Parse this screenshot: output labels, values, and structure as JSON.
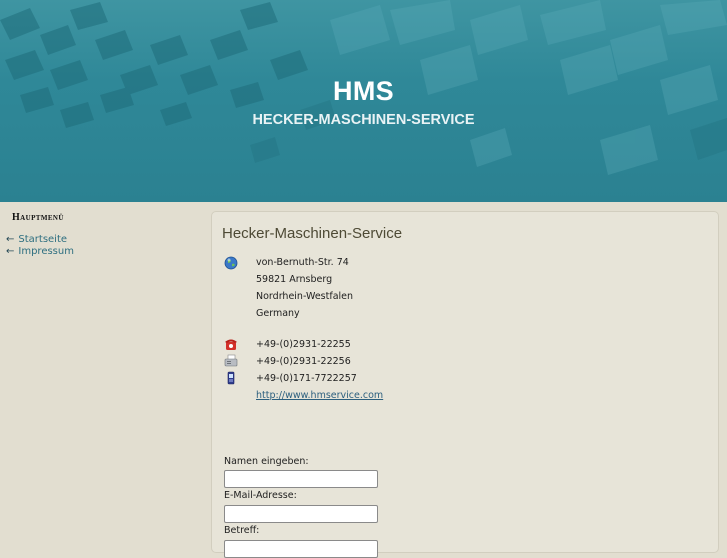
{
  "header": {
    "title": "HMS",
    "subtitle": "HECKER-MASCHINEN-SERVICE"
  },
  "sidebar": {
    "heading": "Hauptmenü",
    "items": [
      {
        "label": "Startseite",
        "icon": "arrow-left-icon"
      },
      {
        "label": "Impressum",
        "icon": "arrow-left-icon"
      }
    ]
  },
  "contact": {
    "title": "Hecker-Maschinen-Service",
    "address_icon": "globe-icon",
    "street": "von-Bernuth-Str. 74",
    "city": "59821 Arnsberg",
    "region": "Nordrhein-Westfalen",
    "country": "Germany",
    "phone_icon": "telephone-icon",
    "phone": "+49-(0)2931-22255",
    "fax_icon": "fax-icon",
    "fax": "+49-(0)2931-22256",
    "mobile_icon": "mobile-phone-icon",
    "mobile": "+49-(0)171-7722257",
    "website": "http://www.hmservice.com"
  },
  "form": {
    "name_label": "Namen eingeben:",
    "name_value": "",
    "email_label": "E-Mail-Adresse:",
    "email_value": "",
    "subject_label": "Betreff:",
    "subject_value": ""
  },
  "colors": {
    "header_bg": "#2f8898",
    "page_bg": "#e2ded0",
    "title_color": "#4e4a35",
    "link_color": "#2c5f7e"
  }
}
